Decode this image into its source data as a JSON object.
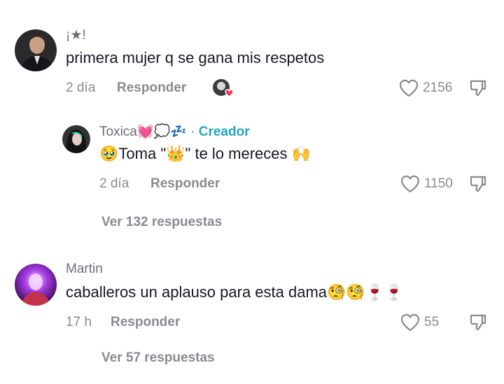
{
  "comments": [
    {
      "username": "¡★!",
      "text": "primera mujer q se gana mis respetos",
      "time": "2 día",
      "reply_label": "Responder",
      "likes": "2156",
      "avatar_icon": "profile-photo-man-in-suit",
      "creator_liked_icon": "creator-avatar-with-heart"
    },
    {
      "username": "Toxica",
      "username_emoji": "💓💭💤",
      "badge_sep": "·",
      "badge": "Creador",
      "text": "Toma \"\" te lo mereces",
      "text_parts": {
        "lead_emoji": "🥹",
        "a": "Toma \"",
        "crown": "👑",
        "b": "\" te lo mereces",
        "end_emoji": "🙌"
      },
      "time": "2 día",
      "reply_label": "Responder",
      "likes": "1150",
      "avatar_icon": "profile-photo-woman-dark-hair"
    },
    {
      "username": "Martin",
      "text": "caballeros un aplauso para esta dama",
      "text_emoji": "🧐🧐🍷🍷",
      "time": "17 h",
      "reply_label": "Responder",
      "likes": "55",
      "avatar_icon": "profile-photo-purple-glow"
    }
  ],
  "view_replies": [
    {
      "label": "Ver 132 respuestas"
    },
    {
      "label": "Ver 57 respuestas"
    }
  ],
  "colors": {
    "accent_creator": "#25a4c9",
    "muted": "#8a8b91",
    "text": "#161823",
    "heart": "#fe2c55"
  }
}
